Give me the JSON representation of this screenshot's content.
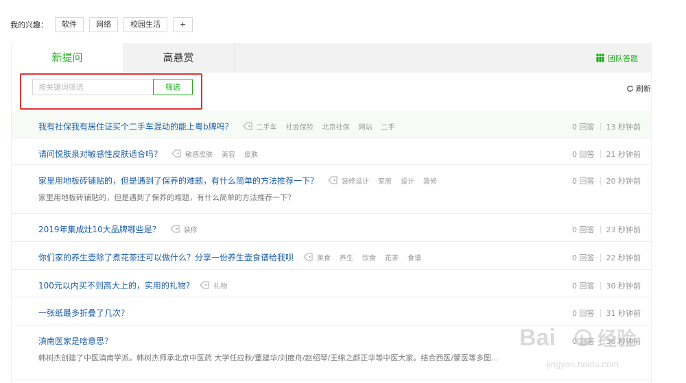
{
  "interests": {
    "label": "我的兴趣：",
    "items": [
      "软件",
      "网络",
      "校园生活"
    ],
    "add_label": "+"
  },
  "tabs": [
    {
      "label": "新提问",
      "active": true
    },
    {
      "label": "高悬赏",
      "active": false
    }
  ],
  "team_answer": {
    "label": "团队答题",
    "icon": "team-icon"
  },
  "filter": {
    "placeholder": "按关键词筛选",
    "button_label": "筛选"
  },
  "refresh": {
    "label": "刷新",
    "icon": "refresh-icon"
  },
  "colors": {
    "accent": "#1aad19",
    "link": "#1c5ea8",
    "highlight": "#e83030"
  },
  "questions": [
    {
      "title": "我有社保我有居住证买个二手车混动的能上粤b牌吗？",
      "tags": [
        "二手车",
        "社会保险",
        "北京社保",
        "网站",
        "二手"
      ],
      "answers": "0 回答",
      "time": "13 秒钟前",
      "desc": "",
      "highlight": true
    },
    {
      "title": "请问悦肤泉对敏感性皮肤适合吗？",
      "tags": [
        "敏感皮肤",
        "美容",
        "皮肤"
      ],
      "answers": "0 回答",
      "time": "21 秒钟前",
      "desc": ""
    },
    {
      "title": "家里用地板砖铺贴的，但是遇到了保养的难题，有什么简单的方法推荐一下？",
      "tags": [
        "装修设计",
        "家居",
        "设计",
        "装修"
      ],
      "answers": "0 回答",
      "time": "20 秒钟前",
      "desc": "家里用地板砖铺贴的，但是遇到了保养的难题，有什么简单的方法推荐一下？"
    },
    {
      "title": "2019年集成灶10大品牌哪些是？",
      "tags": [
        "装修"
      ],
      "answers": "0 回答",
      "time": "23 秒钟前",
      "desc": ""
    },
    {
      "title": "你们家的养生壶除了煮花茶还可以做什么？分享一份养生壶食谱给我呗",
      "tags": [
        "美食",
        "养生",
        "饮食",
        "花茶",
        "食谱"
      ],
      "answers": "0 回答",
      "time": "22 秒钟前",
      "desc": ""
    },
    {
      "title": "100元以内买不到高大上的，实用的礼物?",
      "tags": [
        "礼物"
      ],
      "answers": "0 回答",
      "time": "30 秒钟前",
      "desc": ""
    },
    {
      "title": "一张纸最多折叠了几次？",
      "tags": [],
      "answers": "0 回答",
      "time": "31 秒钟前",
      "desc": ""
    },
    {
      "title": "滇南医家是啥意思？",
      "tags": [],
      "answers": "0 回答",
      "time": "36 秒钟前",
      "desc": "韩树杰创建了中医滇南学派。韩树杰师承北京中医药 大学任应秋/董建华/刘度舟/赵绍琴/王绵之颜正华等中医大家。结合西医/蒙医等多图..."
    }
  ],
  "watermark": {
    "brand": "Bai",
    "brand2": "du",
    "text": "经验",
    "url": "jingyan.baidu.com"
  }
}
